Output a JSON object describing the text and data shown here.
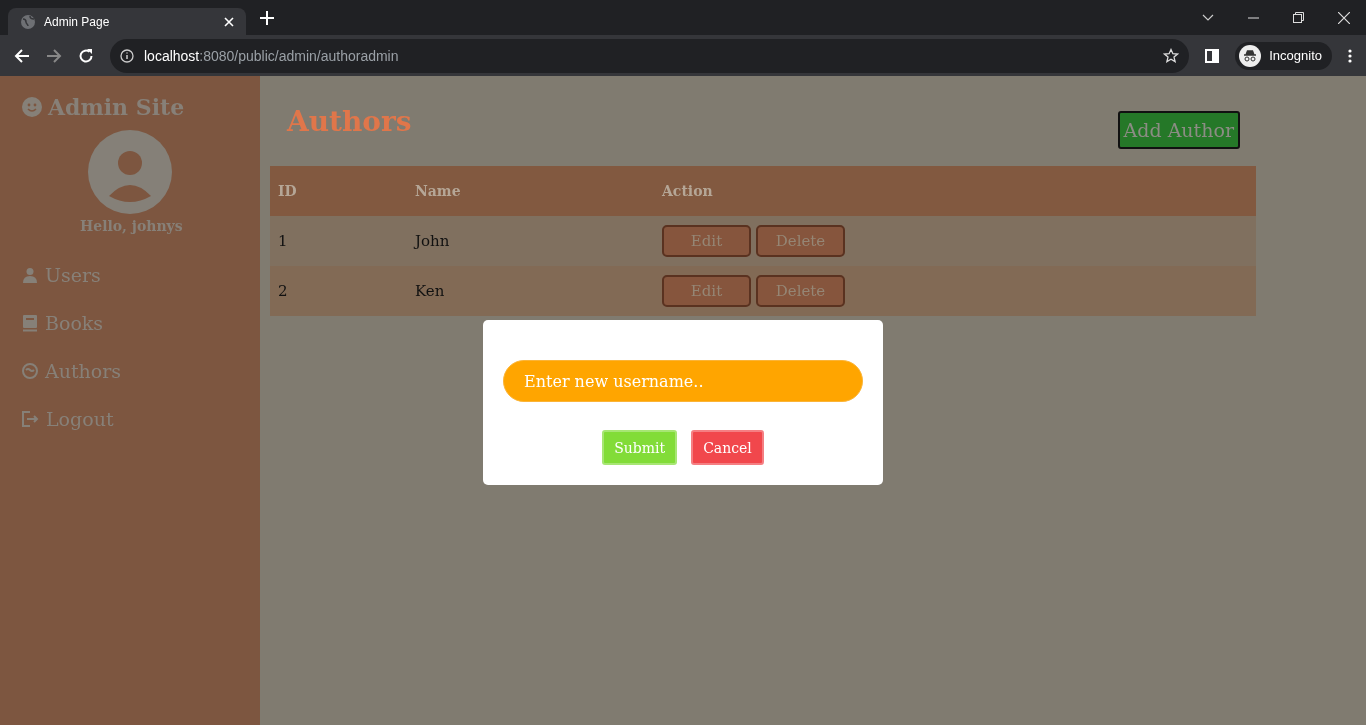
{
  "browser": {
    "tab_title": "Admin Page",
    "url_host": "localhost",
    "url_path": ":8080/public/admin/authoradmin",
    "profile": "Incognito"
  },
  "sidebar": {
    "title": "Admin Site",
    "greeting": "Hello, johnys",
    "items": [
      {
        "label": "Users",
        "kind": "user"
      },
      {
        "label": "Books",
        "kind": "book"
      },
      {
        "label": "Authors",
        "kind": "face"
      },
      {
        "label": "Logout",
        "kind": "logout"
      }
    ]
  },
  "page": {
    "heading": "Authors",
    "add_button": "Add Author"
  },
  "table": {
    "columns": [
      "ID",
      "Name",
      "Action"
    ],
    "rows": [
      {
        "id": "1",
        "name": "John",
        "actions": [
          "Edit",
          "Delete"
        ]
      },
      {
        "id": "2",
        "name": "Ken",
        "actions": [
          "Edit",
          "Delete"
        ]
      }
    ]
  },
  "dialog": {
    "placeholder": "Enter new username..",
    "buttons": [
      {
        "label": "Submit",
        "kind": "submit"
      },
      {
        "label": "Cancel",
        "kind": "cancel"
      }
    ]
  }
}
